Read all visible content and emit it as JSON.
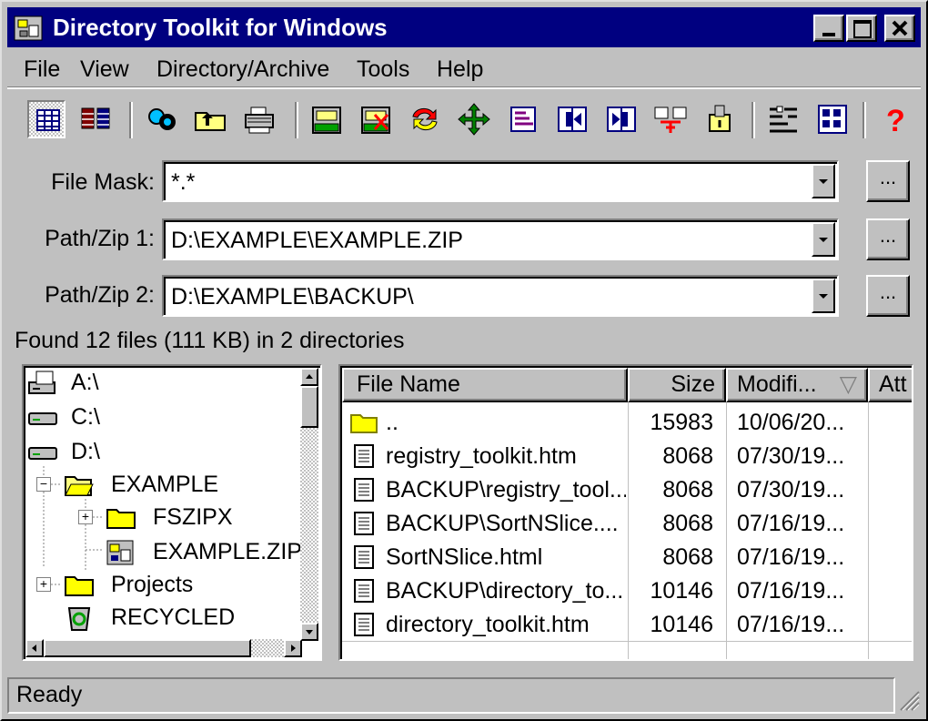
{
  "window": {
    "title": "Directory Toolkit for Windows"
  },
  "menu": [
    "File",
    "View",
    "Directory/Archive",
    "Tools",
    "Help"
  ],
  "toolbar": {
    "icons": [
      "details-view-icon",
      "split-view-icon",
      "find-icon",
      "up-folder-icon",
      "print-icon",
      "archive-add-icon",
      "archive-delete-icon",
      "sync-icon",
      "move-icon",
      "compare-icon",
      "merge-left-icon",
      "merge-right-icon",
      "diff-icon",
      "extract-icon",
      "filter-icon",
      "columns-icon",
      "help-icon"
    ]
  },
  "fields": {
    "file_mask": {
      "label": "File Mask:",
      "value": "*.*",
      "browse": "..."
    },
    "path1": {
      "label": "Path/Zip 1:",
      "value": "D:\\EXAMPLE\\EXAMPLE.ZIP",
      "browse": "..."
    },
    "path2": {
      "label": "Path/Zip 2:",
      "value": "D:\\EXAMPLE\\BACKUP\\",
      "browse": "..."
    }
  },
  "found_text": "Found 12 files (111 KB) in 2 directories",
  "tree": {
    "items": [
      {
        "label": "A:\\",
        "icon": "floppy-drive-icon"
      },
      {
        "label": "C:\\",
        "icon": "hard-drive-icon"
      },
      {
        "label": "D:\\",
        "icon": "hard-drive-icon"
      },
      {
        "label": "EXAMPLE",
        "icon": "open-folder-icon",
        "expander": "−"
      },
      {
        "label": "FSZIPX",
        "icon": "folder-icon",
        "expander": "+"
      },
      {
        "label": "EXAMPLE.ZIP",
        "icon": "zip-archive-icon"
      },
      {
        "label": "Projects",
        "icon": "folder-icon",
        "expander": "+"
      },
      {
        "label": "RECYCLED",
        "icon": "recycle-bin-icon"
      }
    ]
  },
  "list": {
    "columns": [
      "File Name",
      "Size",
      "Modifi...",
      "Att"
    ],
    "sort_indicator": "▽",
    "rows": [
      {
        "name": "..",
        "size": "15983",
        "modified": "10/06/20...",
        "icon": "folder-icon"
      },
      {
        "name": "registry_toolkit.htm",
        "size": "8068",
        "modified": "07/30/19...",
        "icon": "file-icon"
      },
      {
        "name": "BACKUP\\registry_tool...",
        "size": "8068",
        "modified": "07/30/19...",
        "icon": "file-icon"
      },
      {
        "name": "BACKUP\\SortNSlice....",
        "size": "8068",
        "modified": "07/16/19...",
        "icon": "file-icon"
      },
      {
        "name": "SortNSlice.html",
        "size": "8068",
        "modified": "07/16/19...",
        "icon": "file-icon"
      },
      {
        "name": "BACKUP\\directory_to...",
        "size": "10146",
        "modified": "07/16/19...",
        "icon": "file-icon"
      },
      {
        "name": "directory_toolkit.htm",
        "size": "10146",
        "modified": "07/16/19...",
        "icon": "file-icon"
      }
    ]
  },
  "status": "Ready"
}
